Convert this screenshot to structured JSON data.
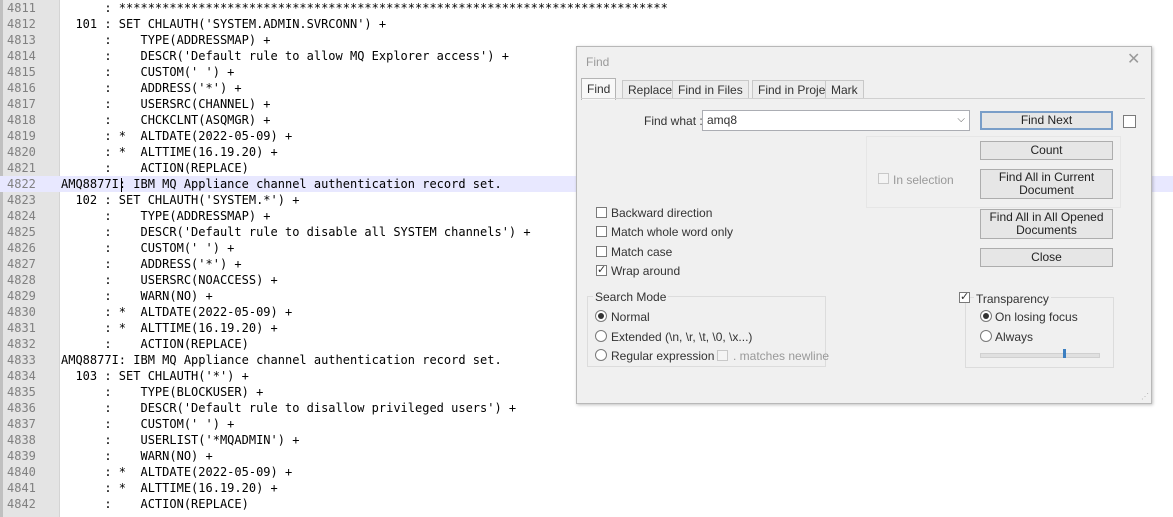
{
  "editor": {
    "lines": [
      {
        "n": "4811",
        "text": "      : ****************************************************************************"
      },
      {
        "n": "4812",
        "text": "  101 : SET CHLAUTH('SYSTEM.ADMIN.SVRCONN') +"
      },
      {
        "n": "4813",
        "text": "      :    TYPE(ADDRESSMAP) +"
      },
      {
        "n": "4814",
        "text": "      :    DESCR('Default rule to allow MQ Explorer access') +"
      },
      {
        "n": "4815",
        "text": "      :    CUSTOM(' ') +"
      },
      {
        "n": "4816",
        "text": "      :    ADDRESS('*') +"
      },
      {
        "n": "4817",
        "text": "      :    USERSRC(CHANNEL) +"
      },
      {
        "n": "4818",
        "text": "      :    CHCKCLNT(ASQMGR) +"
      },
      {
        "n": "4819",
        "text": "      : *  ALTDATE(2022-05-09) +"
      },
      {
        "n": "4820",
        "text": "      : *  ALTTIME(16.19.20) +"
      },
      {
        "n": "4821",
        "text": "      :    ACTION(REPLACE)"
      },
      {
        "n": "4822",
        "text": "AMQ8877I: IBM MQ Appliance channel authentication record set."
      },
      {
        "n": "4823",
        "text": "  102 : SET CHLAUTH('SYSTEM.*') +"
      },
      {
        "n": "4824",
        "text": "      :    TYPE(ADDRESSMAP) +"
      },
      {
        "n": "4825",
        "text": "      :    DESCR('Default rule to disable all SYSTEM channels') +"
      },
      {
        "n": "4826",
        "text": "      :    CUSTOM(' ') +"
      },
      {
        "n": "4827",
        "text": "      :    ADDRESS('*') +"
      },
      {
        "n": "4828",
        "text": "      :    USERSRC(NOACCESS) +"
      },
      {
        "n": "4829",
        "text": "      :    WARN(NO) +"
      },
      {
        "n": "4830",
        "text": "      : *  ALTDATE(2022-05-09) +"
      },
      {
        "n": "4831",
        "text": "      : *  ALTTIME(16.19.20) +"
      },
      {
        "n": "4832",
        "text": "      :    ACTION(REPLACE)"
      },
      {
        "n": "4833",
        "text": "AMQ8877I: IBM MQ Appliance channel authentication record set."
      },
      {
        "n": "4834",
        "text": "  103 : SET CHLAUTH('*') +"
      },
      {
        "n": "4835",
        "text": "      :    TYPE(BLOCKUSER) +"
      },
      {
        "n": "4836",
        "text": "      :    DESCR('Default rule to disallow privileged users') +"
      },
      {
        "n": "4837",
        "text": "      :    CUSTOM(' ') +"
      },
      {
        "n": "4838",
        "text": "      :    USERLIST('*MQADMIN') +"
      },
      {
        "n": "4839",
        "text": "      :    WARN(NO) +"
      },
      {
        "n": "4840",
        "text": "      : *  ALTDATE(2022-05-09) +"
      },
      {
        "n": "4841",
        "text": "      : *  ALTTIME(16.19.20) +"
      },
      {
        "n": "4842",
        "text": "      :    ACTION(REPLACE)"
      }
    ],
    "current_line": "4822"
  },
  "find_dialog": {
    "title": "Find",
    "tabs": [
      "Find",
      "Replace",
      "Find in Files",
      "Find in Projects",
      "Mark"
    ],
    "active_tab": "Find",
    "find_what_label": "Find what :",
    "find_what_value": "amq8",
    "in_selection_label": "In selection",
    "options": {
      "backward_direction": {
        "label": "Backward direction",
        "checked": false
      },
      "match_whole_word": {
        "label": "Match whole word only",
        "checked": false
      },
      "match_case": {
        "label": "Match case",
        "checked": false
      },
      "wrap_around": {
        "label": "Wrap around",
        "checked": true
      }
    },
    "search_mode": {
      "title": "Search Mode",
      "normal": "Normal",
      "extended": "Extended (\\n, \\r, \\t, \\0, \\x...)",
      "regex": "Regular expression",
      "matches_newline": ". matches newline",
      "selected": "Normal"
    },
    "transparency": {
      "label": "Transparency",
      "checked": true,
      "on_losing_focus": "On losing focus",
      "always": "Always",
      "selected": "On losing focus",
      "slider_level": 0.72
    },
    "buttons": {
      "find_next": "Find Next",
      "count": "Count",
      "find_all_current_1": "Find All in Current",
      "find_all_current_2": "Document",
      "find_all_opened_1": "Find All in All Opened",
      "find_all_opened_2": "Documents",
      "close": "Close"
    },
    "icons": {
      "close": "close-icon",
      "dropdown": "chevron-down-icon"
    }
  }
}
